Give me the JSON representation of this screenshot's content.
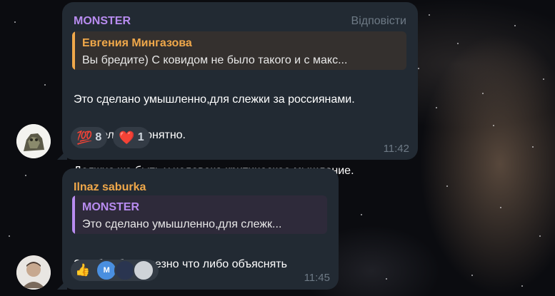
{
  "messages": [
    {
      "sender": "MONSTER",
      "reply_action": "Відповісти",
      "quote": {
        "name": "Евгения Мингазова",
        "text": "Вы бредите) С ковидом не было такого и с макс..."
      },
      "lines": [
        "Это сделано умышленно,для слежки за россиянами.",
        "Неужели не понятно.",
        "Должно же быть.у человека критическое мышление."
      ],
      "reactions": [
        {
          "emoji": "💯",
          "icon": "hundred-points-icon",
          "count": "8"
        },
        {
          "emoji": "❤️",
          "icon": "red-heart-icon",
          "count": "1"
        }
      ],
      "time": "11:42"
    },
    {
      "sender": "Ilnaz saburka",
      "quote": {
        "name": "MONSTER",
        "text": "Это сделано умышленно,для слежк..."
      },
      "lines": [
        "Это бот бесполезно что либо объяснять"
      ],
      "reaction_emoji": "👍",
      "reactor_initial": "M",
      "time": "11:45"
    }
  ],
  "colors": {
    "bubble": "#222a33",
    "monster_name": "#b88cf0",
    "orange_name": "#f0a84a",
    "time": "#6e7a86",
    "reaction_bg": "#333b45"
  }
}
